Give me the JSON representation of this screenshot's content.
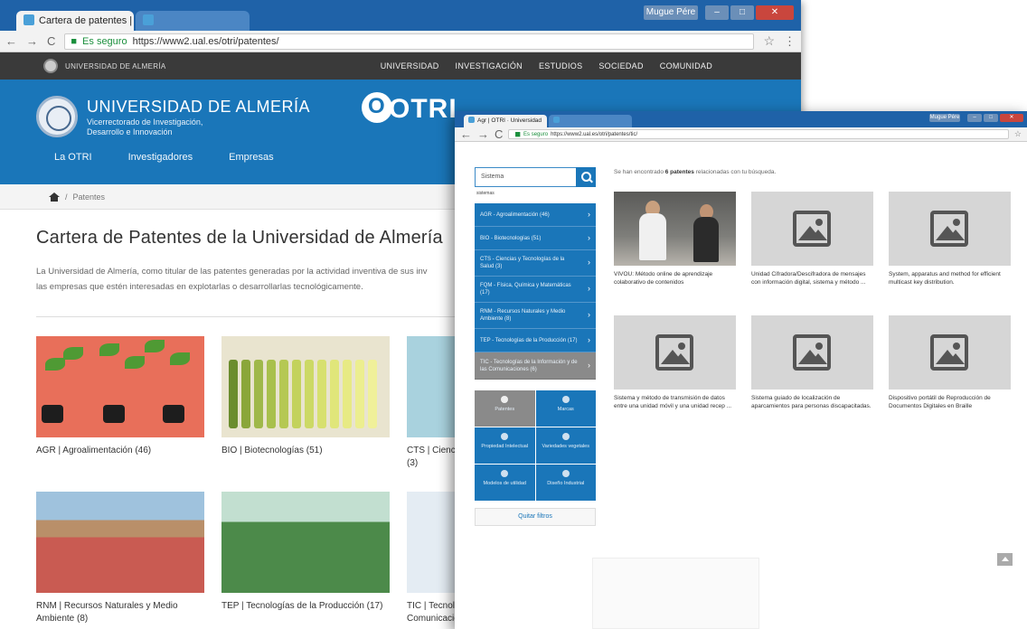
{
  "back_window": {
    "tabs": [
      {
        "label": "Cartera de patentes | OT"
      },
      {
        "label": ""
      }
    ],
    "window_controls": {
      "user_label": "Mugue Pére"
    },
    "address": {
      "secure_label": "Es seguro",
      "url": "https://www2.ual.es/otri/patentes/"
    },
    "topbar": {
      "brand": "Universidad de Almería",
      "menu": [
        "UNIVERSIDAD",
        "INVESTIGACIÓN",
        "ESTUDIOS",
        "SOCIEDAD",
        "COMUNIDAD"
      ]
    },
    "header": {
      "title": "UNIVERSIDAD DE ALMERÍA",
      "subtitle": "Vicerrectorado de Investigación, Desarrollo e Innovación",
      "logo_text": "OTRI"
    },
    "nav": [
      "La OTRI",
      "Investigadores",
      "Empresas"
    ],
    "breadcrumb": {
      "current": "Patentes"
    },
    "page_title": "Cartera de Patentes de la Universidad de Almería",
    "intro_lines": [
      "La Universidad de Almería, como titular de las patentes generadas por la actividad inventiva de sus inv",
      "las empresas que estén interesadas en explotarlas o desarrollarlas tecnológicamente."
    ],
    "categories": [
      {
        "label": "AGR | Agroalimentación (46)"
      },
      {
        "label": "BIO | Biotecnologías (51)"
      },
      {
        "label": "CTS | Cienc (3)"
      },
      {
        "label": "RNM | Recursos Naturales y Medio Ambiente (8)"
      },
      {
        "label": "TEP | Tecnologías de la Producción (17)"
      },
      {
        "label": "TIC | Tecnologías de la Información y las Comunicaciones (6)"
      }
    ]
  },
  "front_window": {
    "tabs": [
      {
        "label": "Agr | OTRI · Universidad"
      },
      {
        "label": ""
      }
    ],
    "window_controls": {
      "user_label": "Mugue Pére"
    },
    "address": {
      "secure_label": "Es seguro",
      "url": "https://www2.ual.es/otri/patentes/tic/"
    },
    "search": {
      "value": "Sistema",
      "suggestion": "sistemas"
    },
    "categories": [
      {
        "label": "AGR - Agroalimentación (46)",
        "selected": false
      },
      {
        "label": "BIO - Biotecnologías (51)",
        "selected": false
      },
      {
        "label": "CTS - Ciencias y Tecnologías de la Salud (3)",
        "selected": false
      },
      {
        "label": "FQM - Física, Química y Matemáticas (17)",
        "selected": false
      },
      {
        "label": "RNM - Recursos Naturales y Medio Ambiente (8)",
        "selected": false
      },
      {
        "label": "TEP - Tecnologías de la Producción (17)",
        "selected": false
      },
      {
        "label": "TIC - Tecnologías de la Información y de las Comunicaciones (6)",
        "selected": true
      }
    ],
    "tools": [
      {
        "label": "Patentes",
        "icon": "gears-icon",
        "selected": true
      },
      {
        "label": "Marcas",
        "icon": "registered-icon",
        "selected": false
      },
      {
        "label": "Propiedad Intelectual",
        "icon": "lightbulb-icon",
        "selected": false
      },
      {
        "label": "Variedades vegetales",
        "icon": "leaf-icon",
        "selected": false
      },
      {
        "label": "Modelos de utilidad",
        "icon": "database-icon",
        "selected": false
      },
      {
        "label": "Diseño Industrial",
        "icon": "leaf-icon",
        "selected": false
      }
    ],
    "more_label": "Quitar filtros",
    "results": {
      "prefix": "Se han encontrado",
      "count": "6 patentes",
      "suffix": "relacionadas con tu búsqueda."
    },
    "patents": [
      {
        "title": "VIVOU: Método online de aprendizaje colaborativo de contenidos",
        "photo": true
      },
      {
        "title": "Unidad Cifradora/Descifradora de mensajes con información digital, sistema y método ...",
        "photo": false
      },
      {
        "title": "System, apparatus and method for efficient multicast key distribution.",
        "photo": false
      },
      {
        "title": "Sistema y método de transmisión de datos entre una unidad móvil y una unidad recep ...",
        "photo": false
      },
      {
        "title": "Sistema guiado de localización de aparcamientos para personas discapacitadas.",
        "photo": false
      },
      {
        "title": "Dispositivo portátil de Reproducción de Documentos Digitales en Braille",
        "photo": false
      }
    ]
  },
  "colors": {
    "brand_blue": "#1a76b9",
    "topbar_dark": "#3a3a3a",
    "selected_grey": "#8a8a8a"
  }
}
